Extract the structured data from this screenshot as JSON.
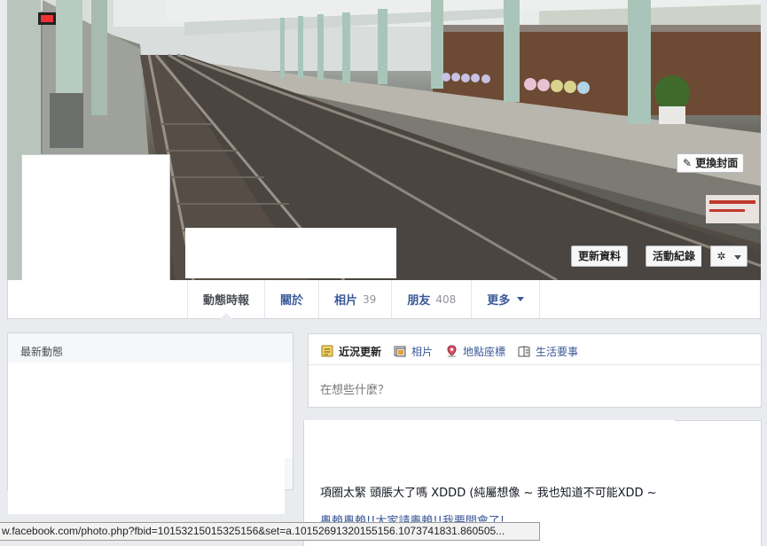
{
  "cover": {
    "change_cover_label": "更換封面",
    "update_info_label": "更新資料",
    "activity_log_label": "活動紀錄",
    "settings_icon": "gear-icon"
  },
  "tabs": [
    {
      "label": "動態時報",
      "count": "",
      "active": true
    },
    {
      "label": "關於",
      "count": ""
    },
    {
      "label": "相片",
      "count": "39"
    },
    {
      "label": "朋友",
      "count": "408"
    },
    {
      "label": "更多",
      "count": ""
    }
  ],
  "recent": {
    "title": "最新動態"
  },
  "composer": {
    "tabs": [
      {
        "label": "近況更新",
        "icon": "status-icon"
      },
      {
        "label": "相片",
        "icon": "photo-icon"
      },
      {
        "label": "地點座標",
        "icon": "location-pin-icon"
      },
      {
        "label": "生活要事",
        "icon": "life-event-icon"
      }
    ],
    "placeholder": "在想些什麼？"
  },
  "post": {
    "text": "項圈太緊 頭脹大了嗎 XDDD (純屬想像 ~ 我也知道不可能XDD ~",
    "second_line": "粵賴粵賴!!大家請粵賴!!我要開會了!"
  },
  "status_bar": {
    "url": "w.facebook.com/photo.php?fbid=10153215015325156&set=a.10152691320155156.1073741831.860505..."
  },
  "colors": {
    "brand_blue": "#3b5998",
    "page_bg": "#e9ebee"
  }
}
